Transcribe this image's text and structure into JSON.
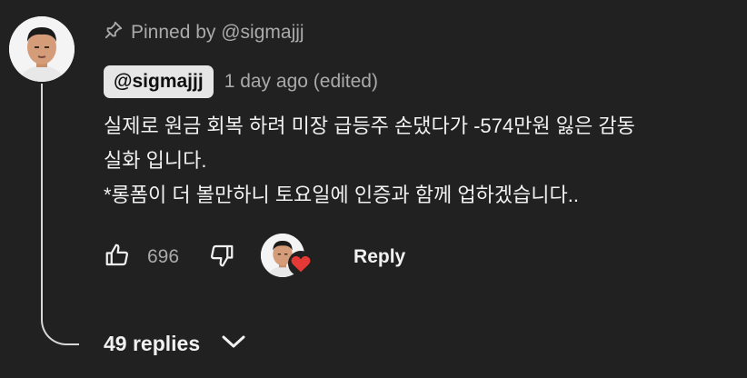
{
  "pinned": {
    "text": "Pinned by @sigmajjj",
    "icon": "pin-icon"
  },
  "comment": {
    "author": "@sigmajjj",
    "timestamp": "1 day ago (edited)",
    "lines": [
      "실제로 원금 회복 하려 미장 급등주 손댔다가 -574만원 잃은 감동",
      "실화 입니다.",
      "*롱폼이 더 볼만하니 토요일에 인증과 함께 업하겠습니다.."
    ]
  },
  "actions": {
    "like_icon": "thumbs-up-icon",
    "like_count": "696",
    "dislike_icon": "thumbs-down-icon",
    "creator_heart_icon": "heart-icon",
    "reply_label": "Reply"
  },
  "replies": {
    "label": "49 replies",
    "icon": "chevron-down-icon"
  },
  "colors": {
    "background": "#212121",
    "text": "#f1f1f1",
    "muted": "#aaaaaa",
    "heart": "#e53935"
  }
}
